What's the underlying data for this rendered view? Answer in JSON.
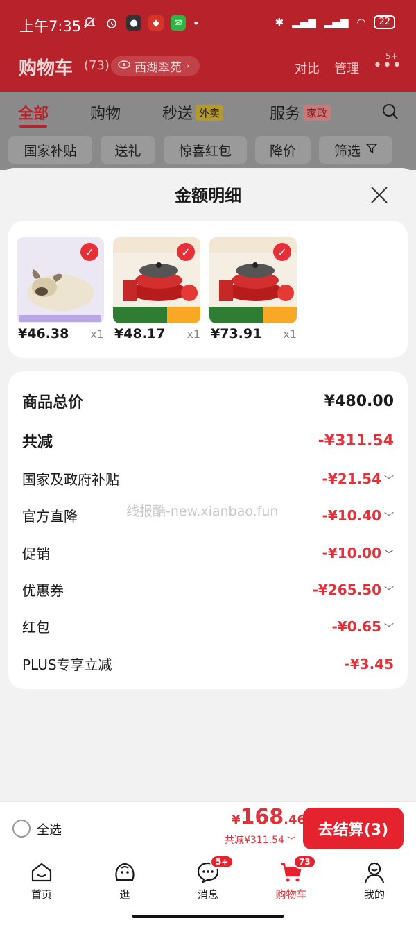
{
  "status_bar": {
    "time": "上午7:35",
    "battery": "22"
  },
  "header": {
    "title": "购物车",
    "count": "(73)",
    "location": "西湖翠苑",
    "compare": "对比",
    "manage": "管理",
    "more_badge": "5+"
  },
  "tabs": [
    {
      "label": "全部"
    },
    {
      "label": "购物"
    },
    {
      "label": "秒送",
      "tag": "外卖"
    },
    {
      "label": "服务",
      "tag": "家政"
    }
  ],
  "filters": [
    "国家补贴",
    "送礼",
    "惊喜红包",
    "降价",
    "筛选"
  ],
  "sheet": {
    "title": "金额明细",
    "products": [
      {
        "price": "¥46.38",
        "qty": "x1",
        "icon": "plush-dog-image"
      },
      {
        "price": "¥48.17",
        "qty": "x1",
        "icon": "red-pot-set-image"
      },
      {
        "price": "¥73.91",
        "qty": "x1",
        "icon": "red-pot-set-image"
      }
    ],
    "breakdown": [
      {
        "label": "商品总价",
        "value": "¥480.00"
      },
      {
        "label": "共减",
        "value": "-¥311.54"
      },
      {
        "label": "国家及政府补贴",
        "value": "-¥21.54"
      },
      {
        "label": "官方直降",
        "value": "-¥10.40"
      },
      {
        "label": "促销",
        "value": "-¥10.00"
      },
      {
        "label": "优惠券",
        "value": "-¥265.50"
      },
      {
        "label": "红包",
        "value": "-¥0.65"
      },
      {
        "label": "PLUS专享立减",
        "value": "-¥3.45"
      }
    ],
    "watermark": "线报酷-new.xianbao.fun"
  },
  "checkout": {
    "select_all": "全选",
    "currency": "¥",
    "total_int": "168",
    "total_dec": ".46",
    "saved": "共减¥311.54",
    "pay_button": "去结算(3)"
  },
  "nav": [
    {
      "label": "首页"
    },
    {
      "label": "逛"
    },
    {
      "label": "消息",
      "badge": "5+"
    },
    {
      "label": "购物车",
      "badge": "73"
    },
    {
      "label": "我的"
    }
  ],
  "colors": {
    "brand_red": "#e5232f",
    "dimmed_red": "#b8222a",
    "price_red": "#e0323b"
  }
}
